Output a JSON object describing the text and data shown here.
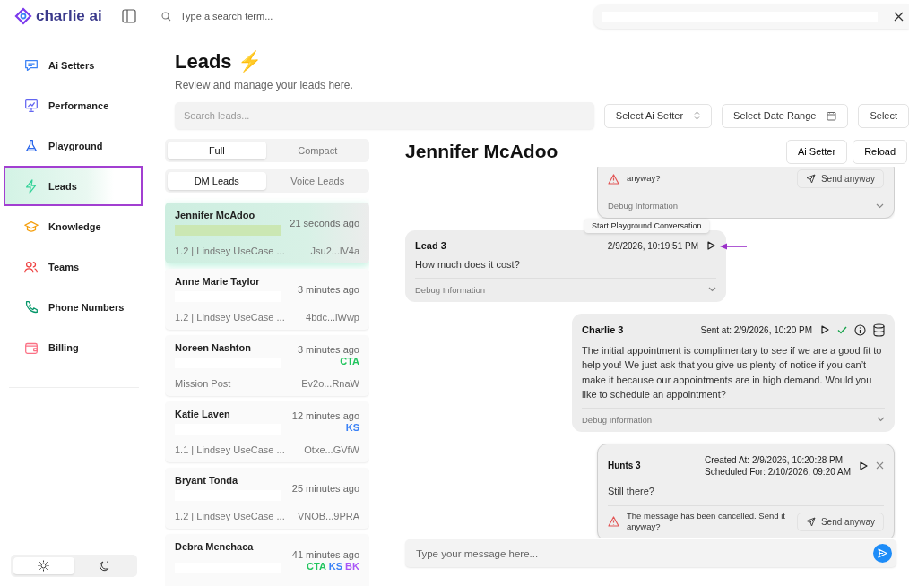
{
  "app": {
    "logo": "charlie ai"
  },
  "top_search": {
    "placeholder": "Type a search term..."
  },
  "sidebar": {
    "items": [
      {
        "label": "Ai Setters",
        "selected": false,
        "highlighted": false
      },
      {
        "label": "Performance",
        "selected": false,
        "highlighted": false
      },
      {
        "label": "Playground",
        "selected": false,
        "highlighted": false
      },
      {
        "label": "Leads",
        "selected": true,
        "highlighted": true
      },
      {
        "label": "Knowledge",
        "selected": false,
        "highlighted": false
      },
      {
        "label": "Teams",
        "selected": false,
        "highlighted": false
      },
      {
        "label": "Phone Numbers",
        "selected": false,
        "highlighted": false
      },
      {
        "label": "Billing",
        "selected": false,
        "highlighted": false
      }
    ],
    "theme_toggle": [
      {
        "kind": "sun",
        "selected": true
      },
      {
        "kind": "moon",
        "selected": false
      }
    ]
  },
  "header": {
    "title": "Leads",
    "title_icon": "⚡",
    "subtitle": "Review and manage your leads here.",
    "search": {
      "placeholder": "Search leads..."
    },
    "filters": [
      {
        "label": "Select Ai Setter",
        "kind": "select"
      },
      {
        "label": "Select Date Range",
        "kind": "date"
      },
      {
        "label": "Select",
        "kind": "plain"
      }
    ]
  },
  "view_toggle": [
    {
      "label": "Full",
      "selected": true
    },
    {
      "label": "Compact",
      "selected": false
    }
  ],
  "channel_toggle": [
    {
      "label": "DM Leads",
      "selected": true
    },
    {
      "label": "Voice Leads",
      "selected": false
    }
  ],
  "leads": [
    {
      "name": "Jennifer McAdoo",
      "time": "21 seconds ago",
      "source": "1.2 | Lindsey UseCase ...",
      "id": "Jsu2...lV4a",
      "selected": true
    },
    {
      "name": "Anne Marie Taylor",
      "time": "3 minutes ago",
      "source": "1.2 | Lindsey UseCase ...",
      "id": "4bdc...iWwp",
      "selected": false
    },
    {
      "name": "Noreen Nashton",
      "time": "3 minutes ago",
      "tags": [
        {
          "label": "CTA",
          "color": "#22c55e"
        }
      ],
      "source": "Mission Post",
      "id": "Ev2o...RnaW",
      "selected": false
    },
    {
      "name": "Katie Laven",
      "time": "12 minutes ago",
      "tags": [
        {
          "label": "KS",
          "color": "#3b82f6"
        }
      ],
      "source": "1.1 | Lindsey UseCase ...",
      "id": "Otxe...GVfW",
      "selected": false
    },
    {
      "name": "Bryant Tonda",
      "time": "25 minutes ago",
      "source": "1.2 | Lindsey UseCase ...",
      "id": "VNOB...9PRA",
      "selected": false
    },
    {
      "name": "Debra Menchaca",
      "time": "41 minutes ago",
      "tags": [
        {
          "label": "CTA",
          "color": "#22c55e"
        },
        {
          "label": "KS",
          "color": "#3b82f6"
        },
        {
          "label": "BK",
          "color": "#a855f7"
        }
      ],
      "selected": false
    }
  ],
  "conversation": {
    "title": "Jennifer McAdoo",
    "buttons": [
      "Ai Setter",
      "Reload"
    ],
    "messages": [
      {
        "kind": "scheduled-tail",
        "warning": "anyway?",
        "action": "Send anyway",
        "debug": "Debug Information"
      },
      {
        "kind": "lead",
        "author": "Lead 3",
        "time": "2/9/2026, 10:19:51 PM",
        "text": "How much does it cost?",
        "debug": "Debug Information",
        "tooltip": "Start Playground Conversation",
        "annotated": true
      },
      {
        "kind": "bot",
        "author": "Charlie 3",
        "time": "Sent at: 2/9/2026, 10:20 PM",
        "text": "The initial appointment is complimentary to see if we are a good fit to help you! We just ask that you give us plenty of notice if you can’t make it because our appointments are in high demand. Would you like to schedule an appointment?",
        "debug": "Debug Information",
        "delivered": true
      },
      {
        "kind": "scheduled",
        "author": "Hunts 3",
        "created": "Created At: 2/9/2026, 10:20:28 PM",
        "scheduled": "Scheduled For: 2/10/2026, 09:20 AM",
        "text": "Still there?",
        "warning": "The message has been cancelled. Send it anyway?",
        "action": "Send anyway"
      }
    ],
    "composer": {
      "placeholder": "Type your message here..."
    }
  }
}
